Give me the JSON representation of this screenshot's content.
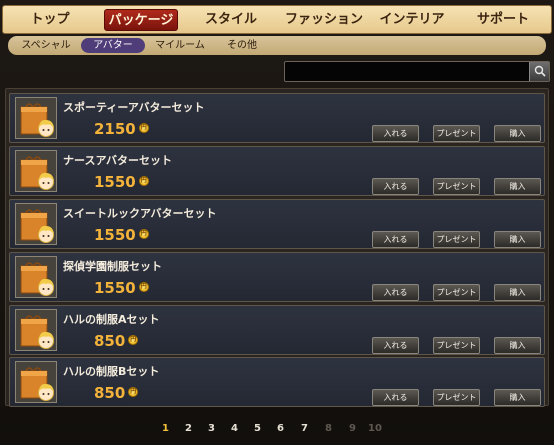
{
  "top_tabs": [
    {
      "label": "トップ",
      "active": false
    },
    {
      "label": "パッケージ",
      "active": true
    },
    {
      "label": "スタイル",
      "active": false
    },
    {
      "label": "ファッション",
      "active": false
    },
    {
      "label": "インテリア",
      "active": false
    },
    {
      "label": "サポート",
      "active": false
    }
  ],
  "sub_tabs": [
    {
      "label": "スペシャル",
      "active": false
    },
    {
      "label": "アバター",
      "active": true
    },
    {
      "label": "マイルーム",
      "active": false
    },
    {
      "label": "その他",
      "active": false
    }
  ],
  "search": {
    "value": "",
    "icon": "magnifier-icon"
  },
  "items": [
    {
      "name": "スポーティーアバターセット",
      "price": "2150"
    },
    {
      "name": "ナースアバターセット",
      "price": "1550"
    },
    {
      "name": "スイートルックアバターセット",
      "price": "1550"
    },
    {
      "name": "探偵学園制服セット",
      "price": "1550"
    },
    {
      "name": "ハルの制服Aセット",
      "price": "850"
    },
    {
      "name": "ハルの制服Bセット",
      "price": "850"
    }
  ],
  "buttons": {
    "put": "入れる",
    "gift": "プレゼント",
    "buy": "購入"
  },
  "currency_icon": "coin-icon",
  "currency_mark": "円",
  "pagination": {
    "pages": [
      "1",
      "2",
      "3",
      "4",
      "5",
      "6",
      "7",
      "8",
      "9",
      "10"
    ],
    "current": "1",
    "enabled_count": 7
  },
  "colors": {
    "price": "#f3b23a",
    "active_top_tab": "#9a2014",
    "active_sub_tab": "#4e3d78",
    "page_current": "#f0c23c",
    "page_enabled": "#e6e0d4",
    "page_disabled": "#5e5850"
  }
}
